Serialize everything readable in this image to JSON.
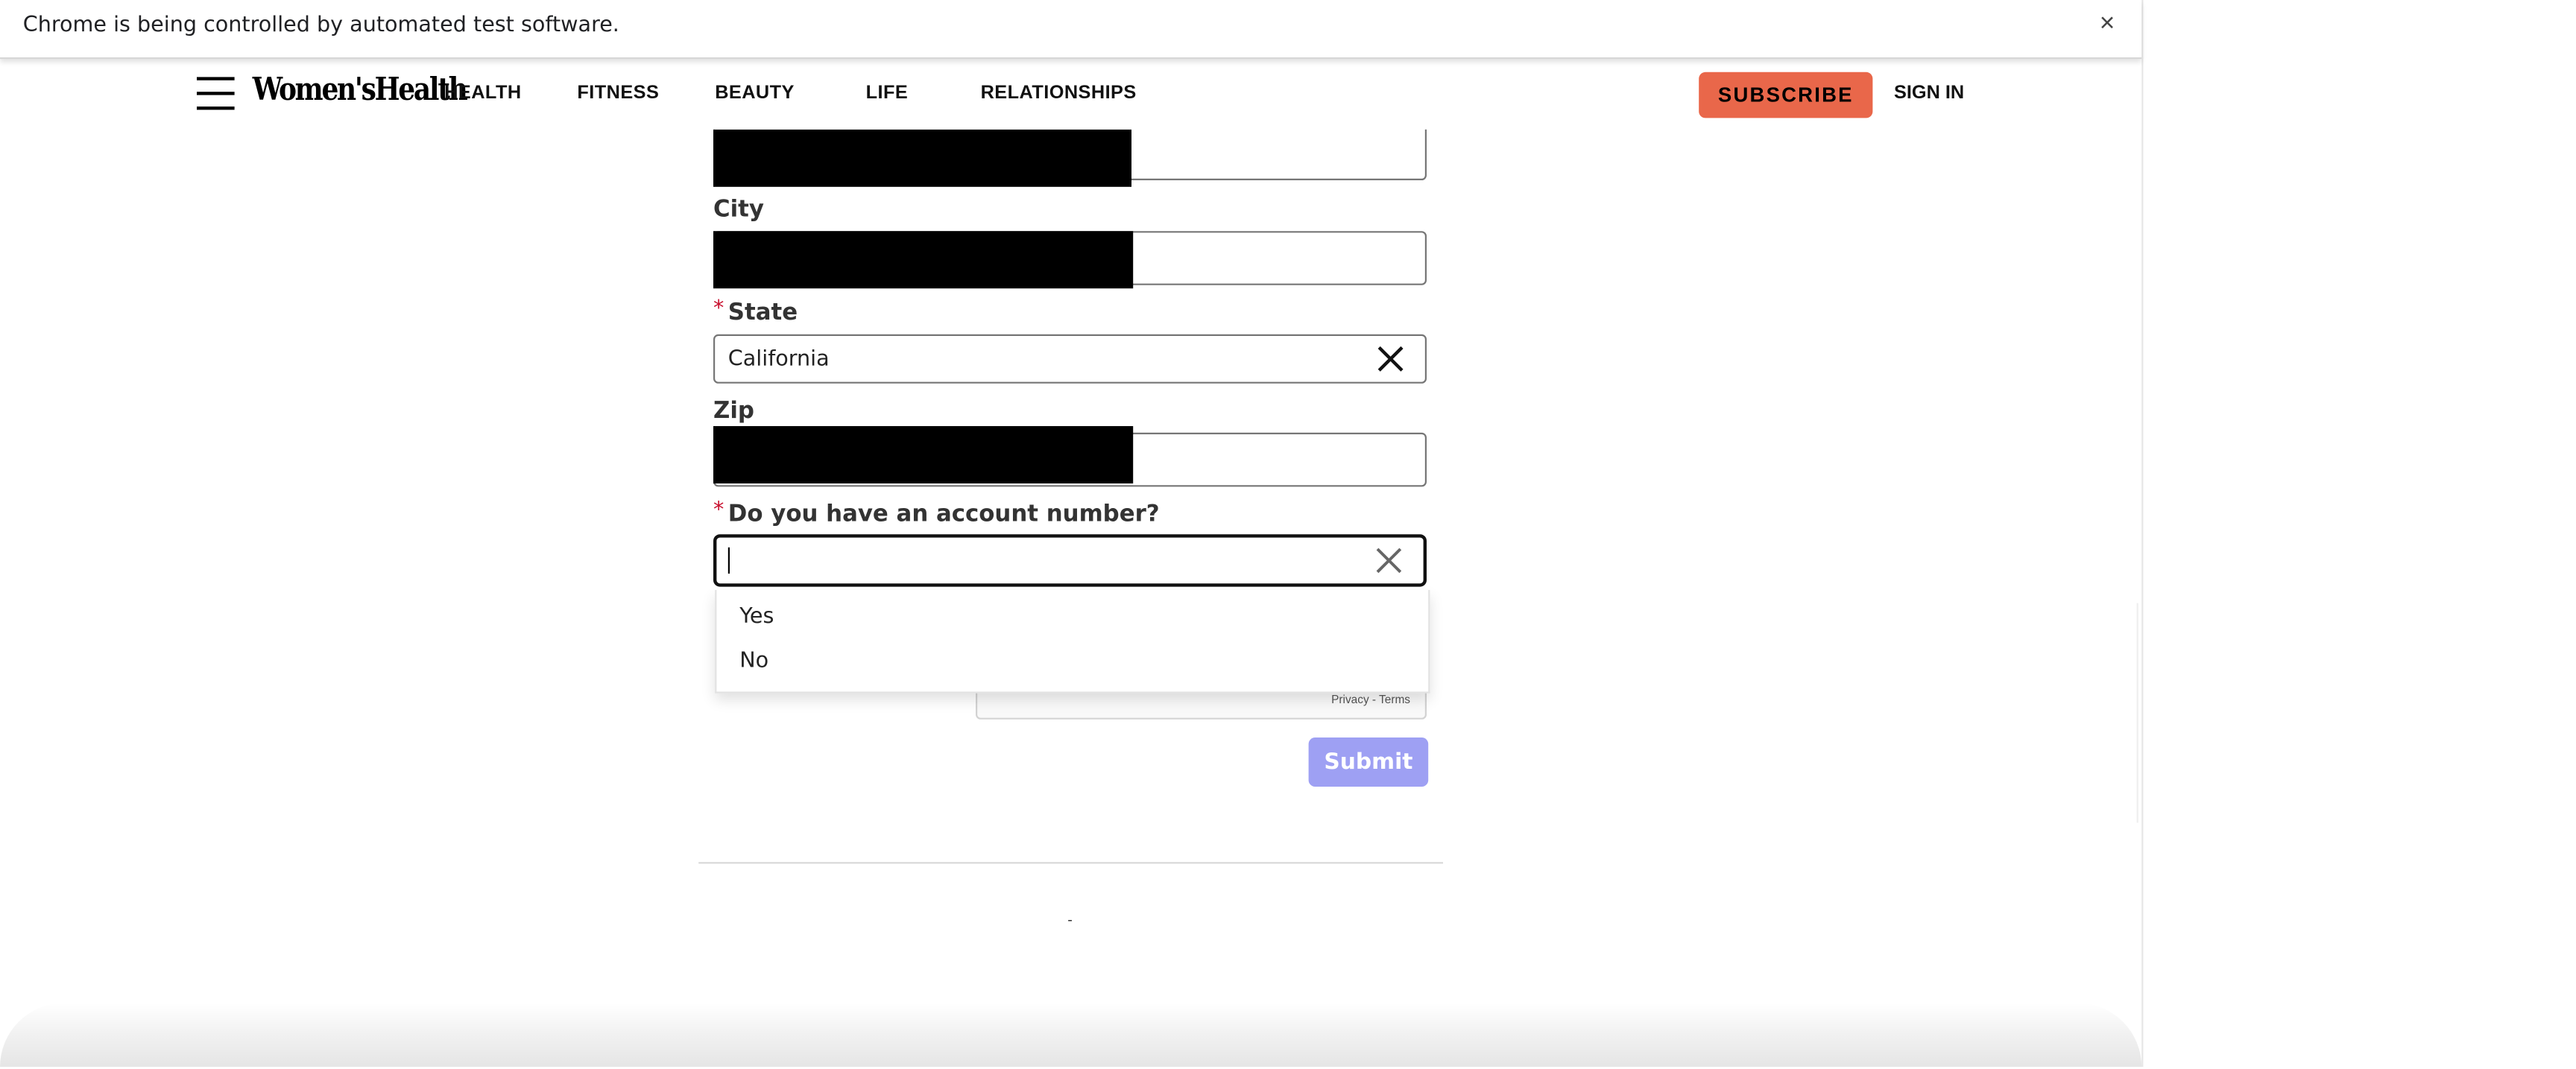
{
  "browser": {
    "infobar_text": "Chrome is being controlled by automated test software.",
    "infobar_close": "×"
  },
  "header": {
    "logo": "Women'sHealth",
    "nav": [
      "HEALTH",
      "FITNESS",
      "BEAUTY",
      "LIFE",
      "RELATIONSHIPS"
    ],
    "subscribe_label": "SUBSCRIBE",
    "signin_label": "SIGN IN"
  },
  "form": {
    "required_marker": "*",
    "city_label": "City",
    "state_label": "State",
    "state_value": "California",
    "zip_label": "Zip",
    "account_question": "Do you have an account number?",
    "account_value": "",
    "account_options": [
      "Yes",
      "No"
    ],
    "recaptcha_links": "Privacy - Terms",
    "submit_label": "Submit"
  },
  "footer": {
    "dot": "-"
  },
  "colors": {
    "subscribe_bg": "#e9674a",
    "submit_bg": "#9ea0f3",
    "required": "#c8102e"
  }
}
